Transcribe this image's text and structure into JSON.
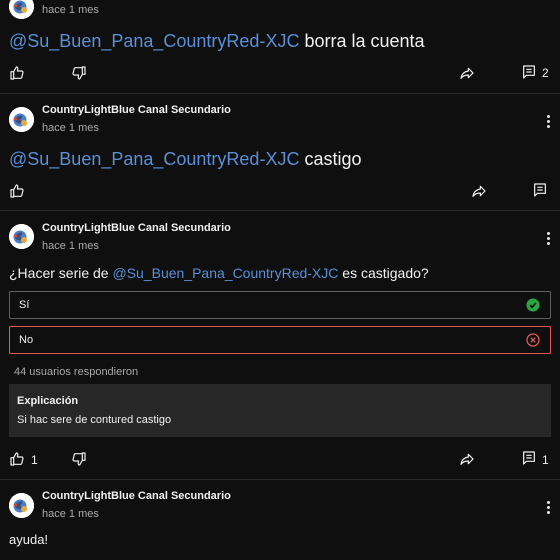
{
  "posts": [
    {
      "time": "hace 1 mes",
      "mention": "@Su_Buen_Pana_CountryRed-XJC",
      "text": " borra la cuenta",
      "reply_count": "2"
    },
    {
      "author": "CountryLightBlue Canal Secundario",
      "time": "hace 1 mes",
      "mention": "@Su_Buen_Pana_CountryRed-XJC",
      "text": " castigo"
    },
    {
      "author": "CountryLightBlue Canal Secundario",
      "time": "hace 1 mes",
      "question_prefix": "¿Hacer serie de ",
      "mention": "@Su_Buen_Pana_CountryRed-XJC",
      "question_suffix": " es castigado?",
      "poll": {
        "options": [
          {
            "label": "Sí",
            "status": "correct"
          },
          {
            "label": "No",
            "status": "wrong"
          }
        ],
        "responders": "44 usuarios respondieron",
        "explanation_title": "Explicación",
        "explanation_text": "Si hac sere de contured castigo"
      },
      "like_count": "1",
      "reply_count": "1"
    },
    {
      "author": "CountryLightBlue Canal Secundario",
      "time": "hace 1 mes",
      "text": "ayuda!"
    }
  ],
  "icons": {
    "like": "thumbs-up-icon",
    "dislike": "thumbs-down-icon",
    "share": "share-icon",
    "comment": "comment-icon",
    "more": "more-vertical-icon",
    "correct": "check-circle-icon",
    "wrong": "x-circle-icon"
  },
  "colors": {
    "background": "#0f0f0f",
    "mention": "#5b8fd6",
    "correct": "#2ba640",
    "wrong": "#e05a5a"
  }
}
